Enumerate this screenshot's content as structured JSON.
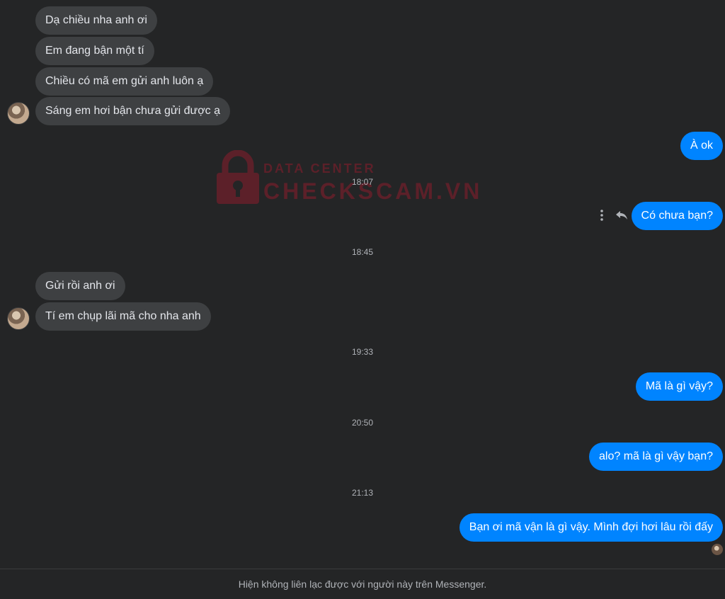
{
  "watermark": {
    "line1": "DATA CENTER",
    "line2": "CHECKSCAM.VN"
  },
  "messages": {
    "m1": "Dạ chiều nha anh ơi",
    "m2": "Em đang bận một tí",
    "m3": "Chiều có mã em gửi anh luôn ạ",
    "m4": "Sáng em hơi bận chưa gửi được ạ",
    "m5": "À ok",
    "m6": "Có chưa bạn?",
    "m7": "Gửi rồi anh ơi",
    "m8": "Tí em chụp lãi mã cho nha anh",
    "m9": "Mã là gì vậy?",
    "m10": "alo? mã là gì vậy bạn?",
    "m11": "Bạn ơi mã vận là gì vậy. Mình đợi hơi lâu rồi đấy"
  },
  "timestamps": {
    "t1": "18:07",
    "t2": "18:45",
    "t3": "19:33",
    "t4": "20:50",
    "t5": "21:13"
  },
  "footer": {
    "notice": "Hiện không liên lạc được với người này trên Messenger."
  },
  "icons": {
    "more": "more-vertical-icon",
    "reply": "reply-icon",
    "lock": "lock-icon"
  },
  "colors": {
    "background": "#242526",
    "incoming_bubble": "#3e4042",
    "outgoing_bubble": "#0084ff",
    "watermark": "#8b1c2c"
  }
}
